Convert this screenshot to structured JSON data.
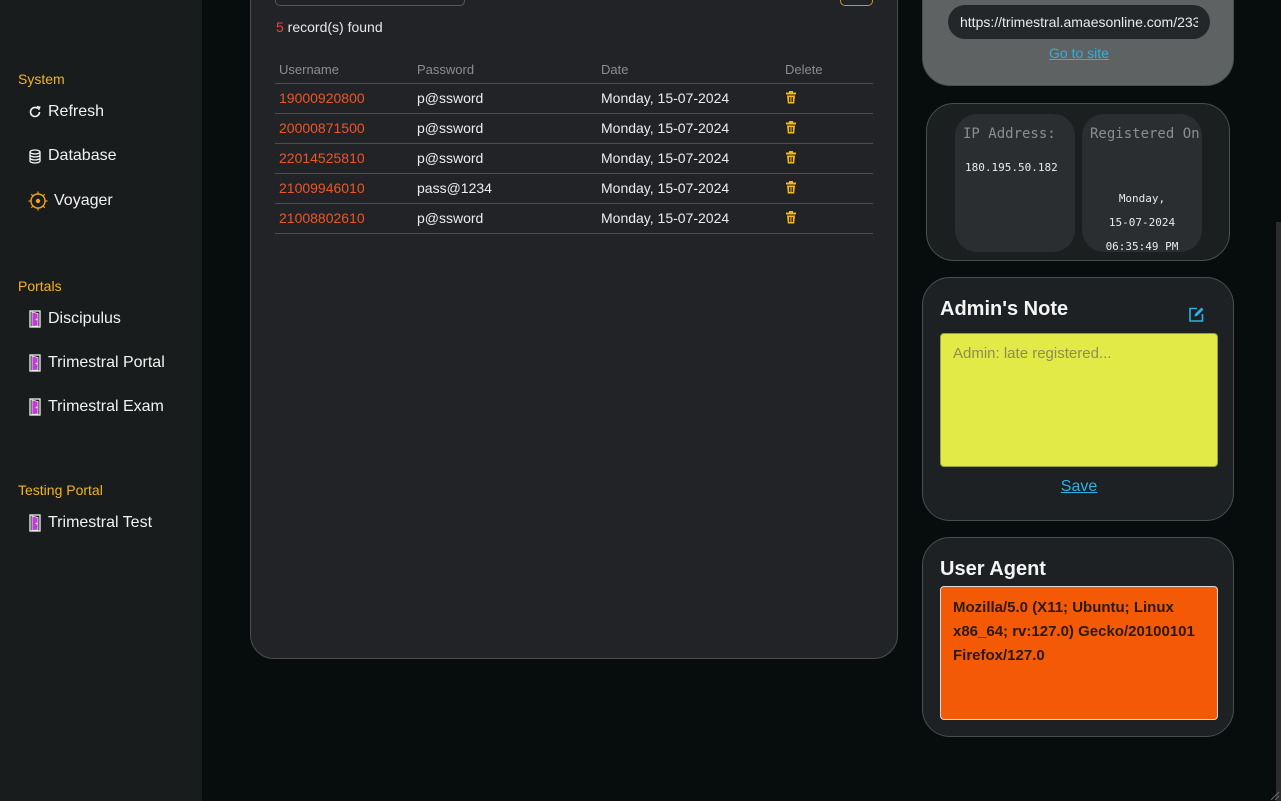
{
  "sidebar": {
    "sections": [
      {
        "label": "System",
        "items": [
          {
            "label": "Refresh",
            "icon": "refresh-icon"
          },
          {
            "label": "Database",
            "icon": "database-icon"
          },
          {
            "label": "Voyager",
            "icon": "voyager-icon"
          }
        ]
      },
      {
        "label": "Portals",
        "items": [
          {
            "label": "Discipulus",
            "icon": "door-icon"
          },
          {
            "label": "Trimestral Portal",
            "icon": "door-icon"
          },
          {
            "label": "Trimestral Exam",
            "icon": "door-icon"
          }
        ]
      },
      {
        "label": "Testing Portal",
        "items": [
          {
            "label": "Trimestral Test",
            "icon": "door-icon"
          }
        ]
      }
    ]
  },
  "records": {
    "count": "5",
    "suffix": " record(s) found",
    "columns": [
      "Username",
      "Password",
      "Date",
      "Delete"
    ],
    "rows": [
      {
        "username": "19000920800",
        "password": "p@ssword",
        "date": "Monday, 15-07-2024"
      },
      {
        "username": "20000871500",
        "password": "p@ssword",
        "date": "Monday, 15-07-2024"
      },
      {
        "username": "22014525810",
        "password": "p@ssword",
        "date": "Monday, 15-07-2024"
      },
      {
        "username": "21009946010",
        "password": "pass@1234",
        "date": "Monday, 15-07-2024"
      },
      {
        "username": "21008802610",
        "password": "p@ssword",
        "date": "Monday, 15-07-2024"
      }
    ]
  },
  "site": {
    "url": "https://trimestral.amaesonline.com/233",
    "go_label": "Go to site"
  },
  "ip_card": {
    "ip_label": "IP Address:",
    "ip_value": "180.195.50.182",
    "reg_label": "Registered On",
    "reg_line1": "Monday,",
    "reg_line2": "15-07-2024",
    "reg_line3": "06:35:49 PM"
  },
  "note": {
    "title": "Admin's Note",
    "placeholder": "Admin: late registered...",
    "save_label": "Save"
  },
  "user_agent": {
    "title": "User Agent",
    "value": "Mozilla/5.0 (X11; Ubuntu; Linux x86_64; rv:127.0) Gecko/20100101 Firefox/127.0"
  },
  "colors": {
    "accent": "#f4b51c",
    "username": "#e8572a",
    "link": "#2db0e3",
    "note_bg": "#e2ea47",
    "ua_bg": "#f45a05"
  }
}
